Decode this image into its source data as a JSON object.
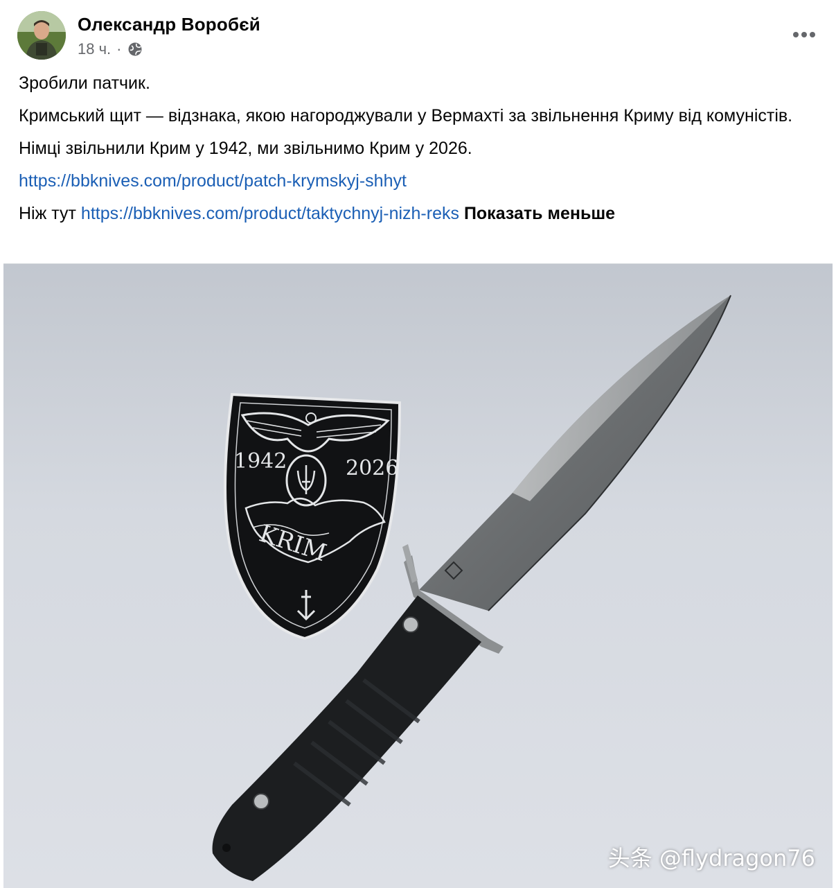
{
  "post": {
    "author": "Олександр Воробєй",
    "time": "18 ч.",
    "separator": "·",
    "privacy_icon": "globe-icon",
    "more_icon": "more-options-icon",
    "paragraphs": {
      "p1": "Зробили патчик.",
      "p2": "Кримський щит — відзнака, якою нагороджували у Вермахті за звільнення Криму від комуністів.",
      "p3": "Німці звільнили Крим у 1942, ми звільнимо Крим у 2026.",
      "link1": "https://bbknives.com/product/patch-krymskyj-shhyt",
      "p5_prefix": "Ніж тут",
      "link2": "https://bbknives.com/product/taktychnyj-nizh-reks",
      "show_less": "Показать меньше"
    }
  },
  "photo": {
    "patch_year_left": "1942",
    "patch_year_right": "2026",
    "patch_text": "KRIM",
    "watermark": "头条 @flydragon76"
  },
  "colors": {
    "link": "#1b5fb5",
    "text": "#050505",
    "meta": "#65676b"
  }
}
